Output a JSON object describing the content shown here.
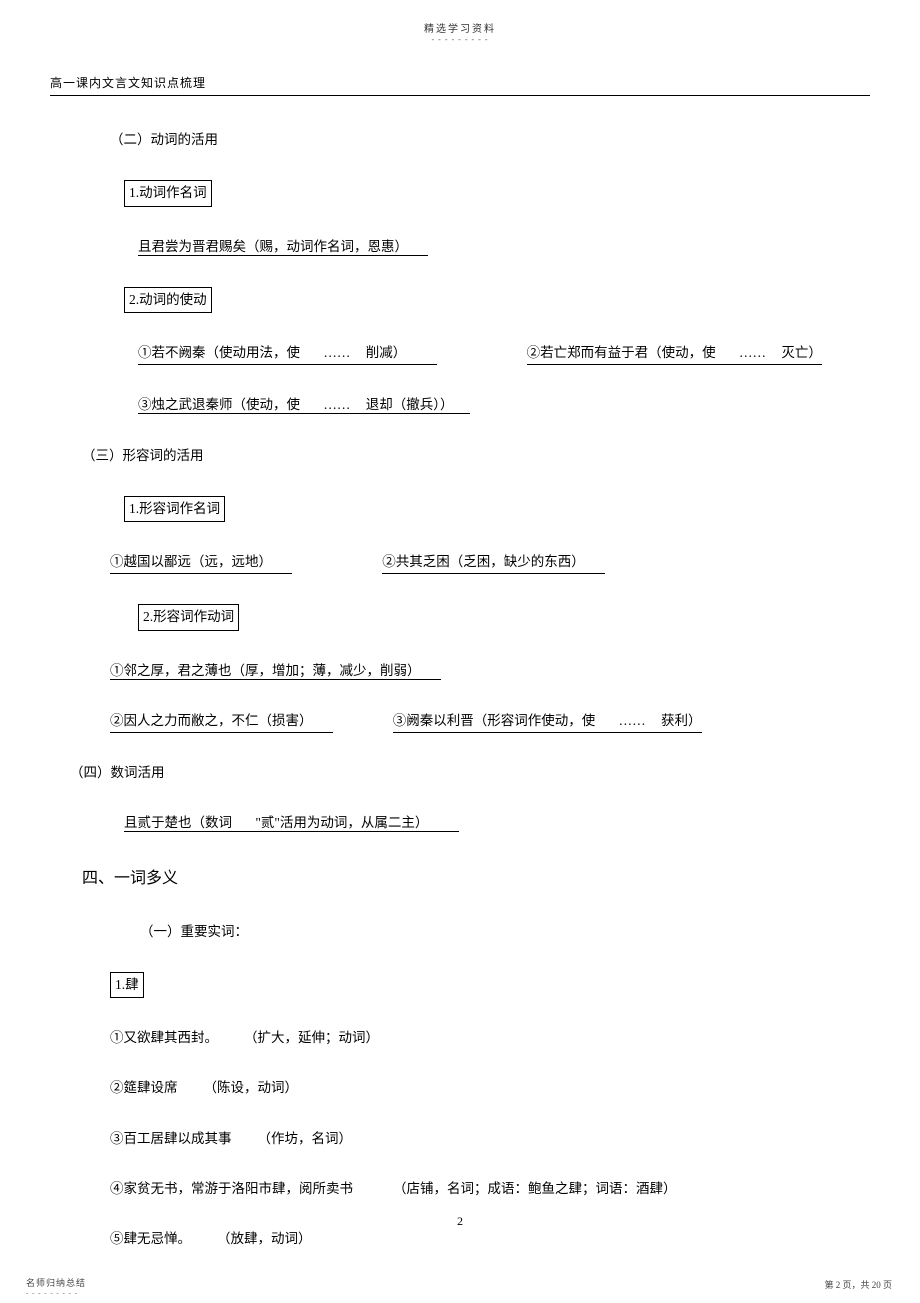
{
  "header": {
    "top": "精选学习资料",
    "dashes": "- - - - - - - - -"
  },
  "doc_title": "高一课内文言文知识点梳理",
  "s2": {
    "title": "（二）动词的活用",
    "item1_box": "1.动词作名词",
    "item1_ex": "且君尝为晋君赐矣（赐，动词作名词，恩惠）",
    "item1_ex_pad": "　　",
    "item2_box": "2.动词的使动",
    "item2_ex1a": "①若不阙秦（使动用法，使",
    "item2_dots": "……",
    "item2_ex1b": "削减）",
    "item2_pad1": "　　",
    "item2_ex2a": "②若亡郑而有益于君（使动，使",
    "item2_ex2b": "灭亡）",
    "item2_ex3a": "③烛之武退秦师（使动，使",
    "item2_ex3b": "退却（撤兵））",
    "item2_pad3": "　"
  },
  "s3": {
    "title": "（三）形容词的活用",
    "item1_box": "1.形容词作名词",
    "item1_ex1": "①越国以鄙远（远，远地）",
    "item1_ex1_pad": "　　",
    "item1_ex2": "②共其乏困（乏困，缺少的东西）",
    "item1_ex2_pad": "　　",
    "item2_box": "2.形容词作动词",
    "item2_ex1": "①邻之厚，君之薄也（厚，增加；薄，减少，削弱）",
    "item2_ex1_pad": "　　",
    "item2_ex2": "②因人之力而敝之，不仁（损害）",
    "item2_ex2_pad": "　　",
    "item2_ex3a": "③阙秦以利晋（形容词作使动，使",
    "item2_dots": "……",
    "item2_ex3b": "获利）"
  },
  "s4": {
    "title": "（四）数词活用",
    "ex_a": "且贰于楚也（数词",
    "ex_b": "\"贰\"活用为动词，从属二主）",
    "ex_pad": "　　"
  },
  "h4": "四、一词多义",
  "s_shi": {
    "title": "（一）重要实词：",
    "box": "1.肆",
    "l1a": "①又欲肆其西封。",
    "l1b": "（扩大，延伸；动词）",
    "l2a": "②筵肆设席",
    "l2b": "（陈设，动词）",
    "l3a": "③百工居肆以成其事",
    "l3b": "（作坊，名词）",
    "l4a": "④家贫无书，常游于洛阳市肆，阅所卖书",
    "l4b": "（店铺，名词；成语：鲍鱼之肆；词语：酒肆）",
    "l5a": "⑤肆无忌惮。",
    "l5b": "（放肆，动词）"
  },
  "page_number": "2",
  "footer": {
    "left": "名师归纳总结",
    "left_dashes": "- - - - - - - - -",
    "right": "第 2 页，共 20 页"
  }
}
